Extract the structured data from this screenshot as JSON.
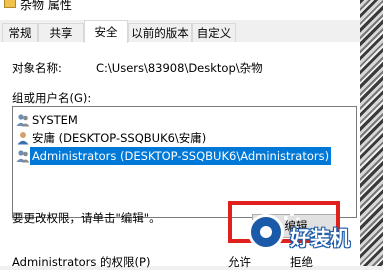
{
  "window": {
    "title": "杂物 属性"
  },
  "tabs": [
    {
      "label": "常规"
    },
    {
      "label": "共享"
    },
    {
      "label": "安全"
    },
    {
      "label": "以前的版本"
    },
    {
      "label": "自定义"
    }
  ],
  "active_tab": "安全",
  "object": {
    "label": "对象名称:",
    "value": "C:\\Users\\83908\\Desktop\\杂物"
  },
  "groups": {
    "label": "组或用户名(G):",
    "items": [
      {
        "name": "SYSTEM",
        "icon": "users-group-icon"
      },
      {
        "name": "安庸 (DESKTOP-SSQBUK6\\安庸)",
        "icon": "user-icon"
      },
      {
        "name": "Administrators (DESKTOP-SSQBUK6\\Administrators)",
        "icon": "users-group-icon",
        "selected": true
      }
    ]
  },
  "hint": "要更改权限，请单击\"编辑\"。",
  "edit_button": {
    "label": "编辑"
  },
  "permissions": {
    "label": "Administrators 的权限(P)",
    "allow_header": "允许",
    "deny_header": "拒绝"
  },
  "watermark": {
    "text": "好装机"
  },
  "colors": {
    "selection": "#0078d7",
    "highlight_box": "#e0201c"
  }
}
